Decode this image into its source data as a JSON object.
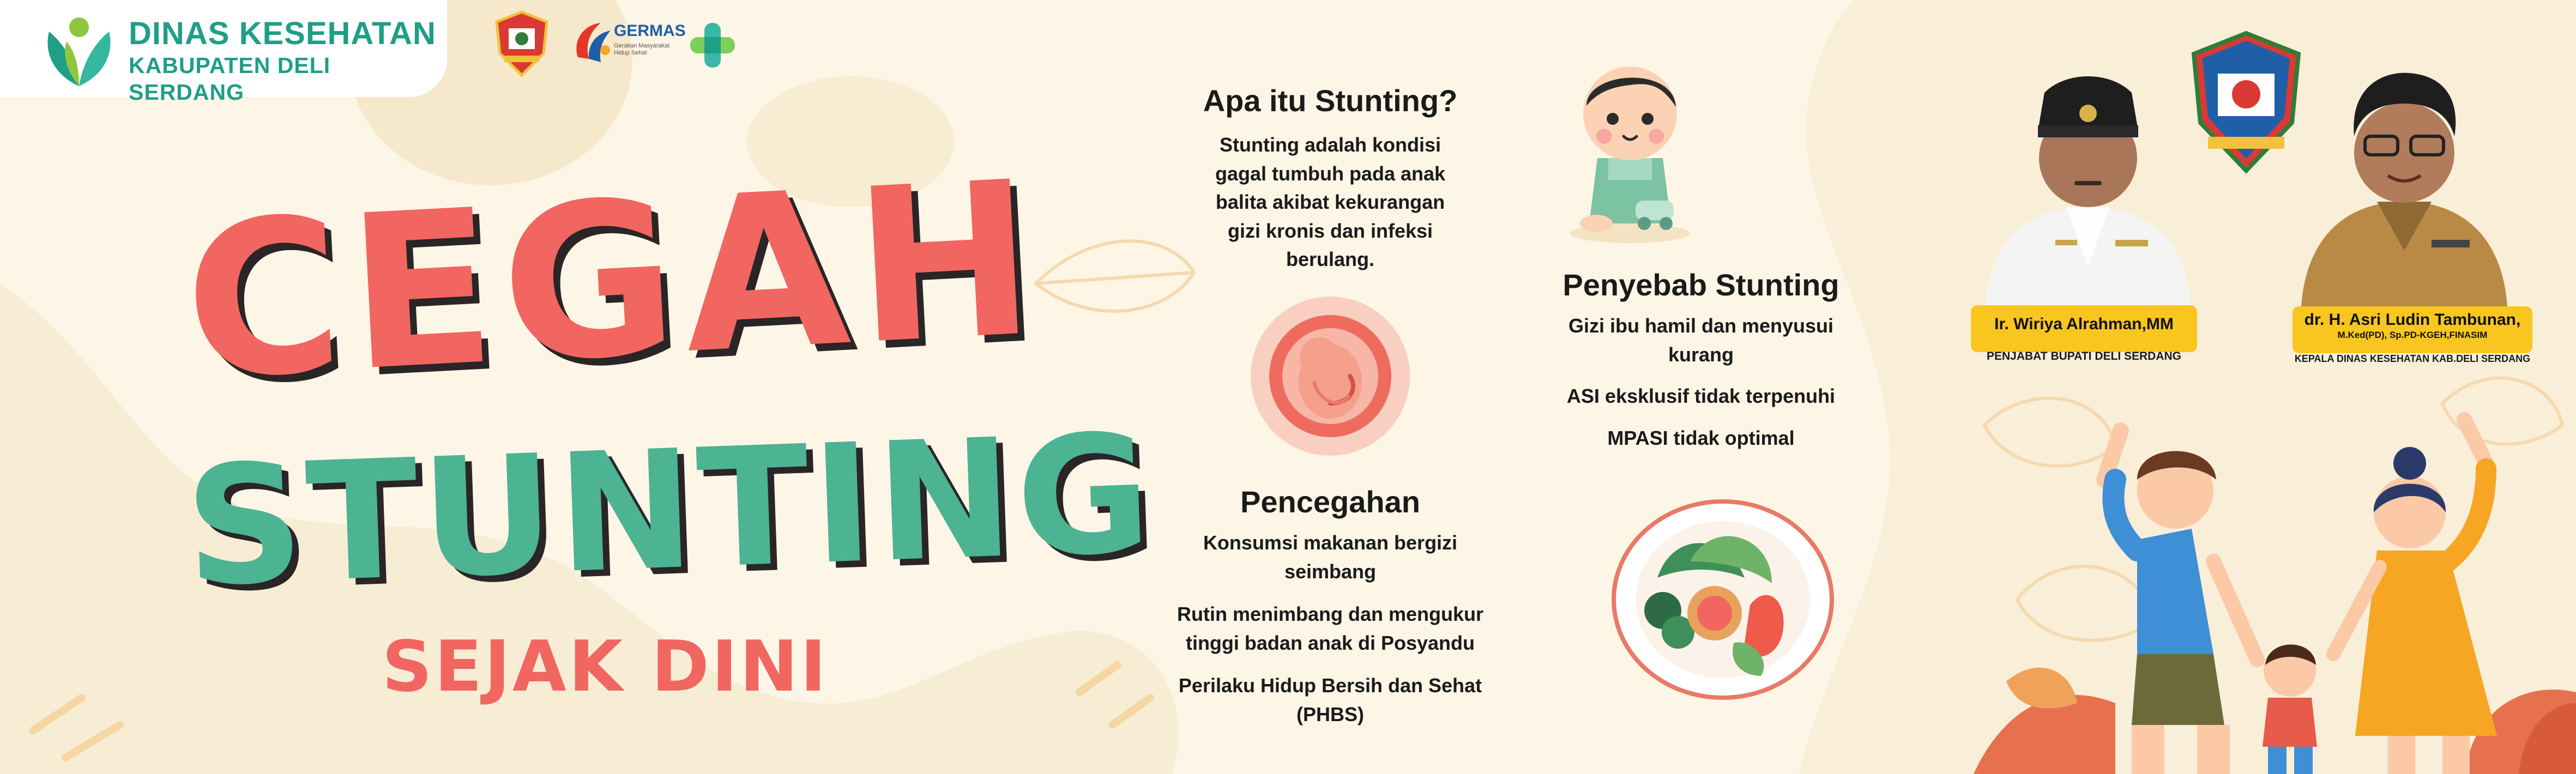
{
  "header": {
    "agency_line1": "DINAS KESEHATAN",
    "agency_line2": "KABUPATEN DELI SERDANG",
    "germas_title": "GERMAS",
    "germas_subtitle": "Gerakan Masyarakat Hidup Sehat"
  },
  "title": {
    "line1": "CEGAH",
    "line2": "STUNTING",
    "line3": "SEJAK DINI"
  },
  "sections": {
    "about": {
      "heading": "Apa itu Stunting?",
      "lines": [
        "Stunting adalah kondisi",
        "gagal tumbuh pada anak",
        "balita akibat kekurangan",
        "gizi kronis dan infeksi",
        "berulang."
      ]
    },
    "causes": {
      "heading": "Penyebab Stunting",
      "items": [
        {
          "lines": [
            "Gizi ibu hamil dan menyusui",
            "kurang"
          ]
        },
        {
          "lines": [
            "ASI eksklusif tidak terpenuhi"
          ]
        },
        {
          "lines": [
            "MPASI tidak optimal"
          ]
        }
      ]
    },
    "prevention": {
      "heading": "Pencegahan",
      "items": [
        {
          "lines": [
            "Konsumsi makanan bergizi",
            "seimbang"
          ]
        },
        {
          "lines": [
            "Rutin menimbang dan mengukur",
            "tinggi badan anak di Posyandu"
          ]
        },
        {
          "lines": [
            "Perilaku Hidup Bersih dan Sehat",
            "(PHBS)"
          ]
        }
      ]
    }
  },
  "officials": [
    {
      "name": "Ir. Wiriya Alrahman,MM",
      "credentials": "",
      "role": "PENJABAT BUPATI DELI SERDANG"
    },
    {
      "name": "dr. H. Asri Ludin Tambunan,",
      "credentials": "M.Ked(PD), Sp.PD-KGEH,FINASIM",
      "role": "KEPALA DINAS KESEHATAN KAB.DELI SERDANG"
    }
  ],
  "colors": {
    "background": "#fdf6e6",
    "coral": "#f16660",
    "teal": "#4cb393",
    "agency_green": "#1f9e88",
    "name_tag": "#f8c61f",
    "outline": "#2a2526"
  },
  "icons": [
    "agency-leaf-logo",
    "deli-serdang-emblem-icon",
    "germas-logo-icon",
    "kemenkes-logo-icon",
    "toddler-illustration",
    "fetus-illustration",
    "healthy-food-plate-illustration",
    "family-illustration",
    "official-portrait"
  ]
}
